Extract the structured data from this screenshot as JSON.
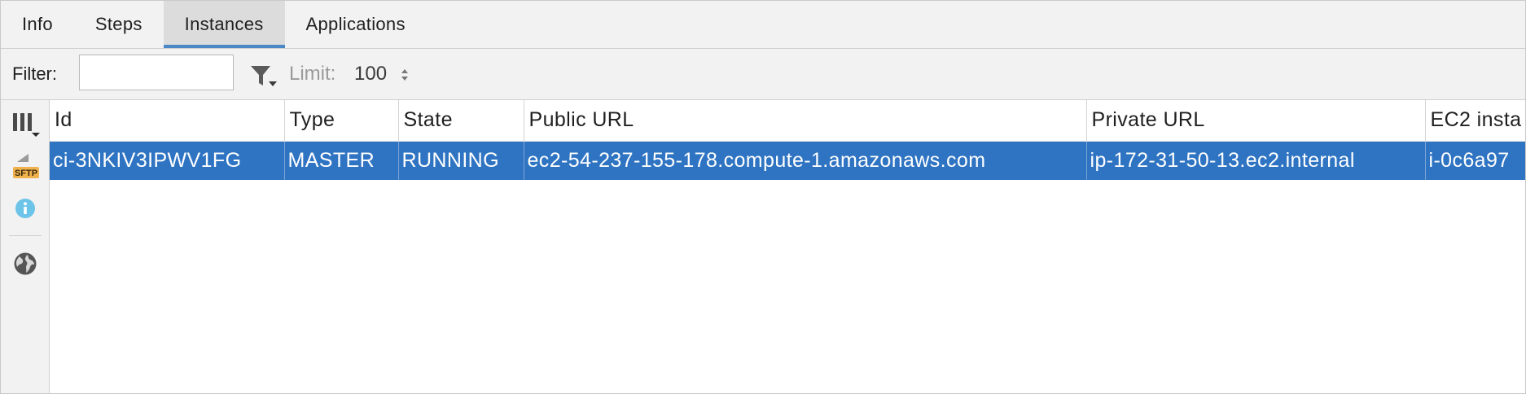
{
  "tabs": [
    {
      "label": "Info",
      "active": false
    },
    {
      "label": "Steps",
      "active": false
    },
    {
      "label": "Instances",
      "active": true
    },
    {
      "label": "Applications",
      "active": false
    }
  ],
  "toolbar": {
    "filter_label": "Filter:",
    "filter_value": "",
    "limit_label": "Limit:",
    "limit_value": "100"
  },
  "side_icons": [
    "columns-icon",
    "sftp-icon",
    "info-icon",
    "globe-icon"
  ],
  "side_icon_text": {
    "sftp": "SFTP"
  },
  "table": {
    "columns": [
      "Id",
      "Type",
      "State",
      "Public URL",
      "Private URL",
      "EC2 insta"
    ],
    "rows": [
      {
        "selected": true,
        "cells": [
          "ci-3NKIV3IPWV1FG",
          "MASTER",
          "RUNNING",
          "ec2-54-237-155-178.compute-1.amazonaws.com",
          "ip-172-31-50-13.ec2.internal",
          "i-0c6a97"
        ]
      }
    ]
  },
  "colors": {
    "selection": "#2f74c2",
    "tab_active_underline": "#4a88c7",
    "info_icon": "#6cc4e8"
  }
}
